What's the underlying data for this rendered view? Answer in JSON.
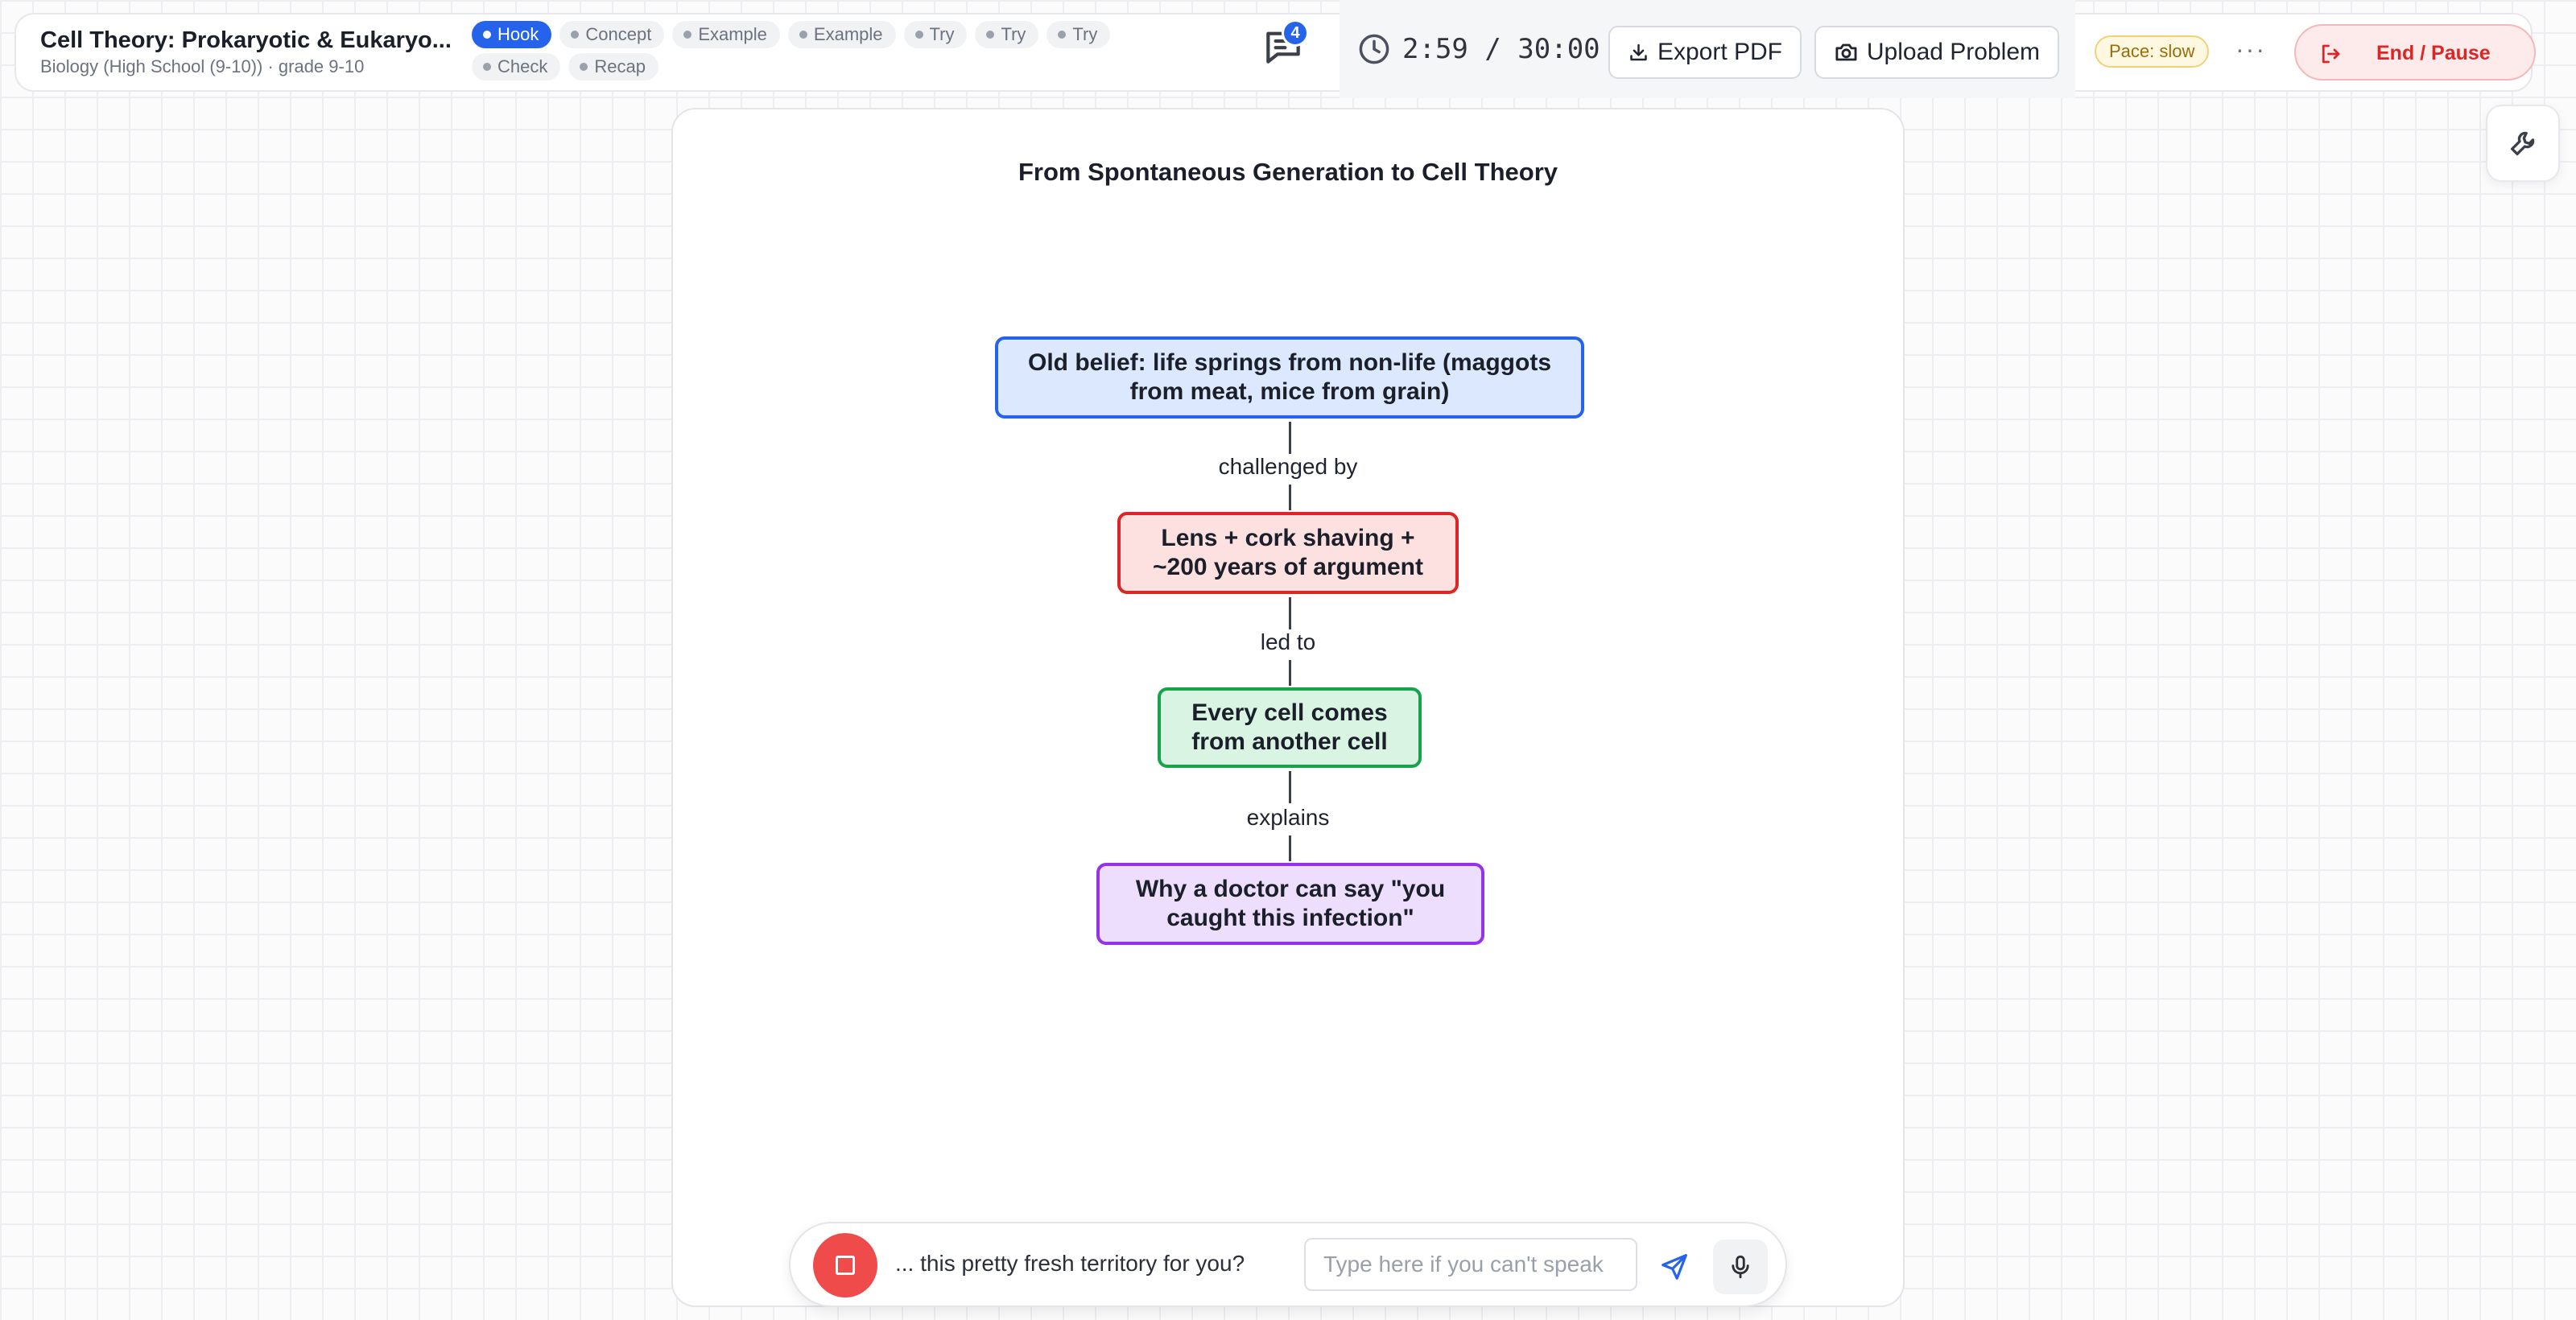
{
  "header": {
    "title": "Cell Theory: Prokaryotic & Eukaryo...",
    "subtitle": "Biology (High School (9-10)) · grade 9-10",
    "chips": [
      {
        "label": "Hook",
        "active": true
      },
      {
        "label": "Concept",
        "active": false
      },
      {
        "label": "Example",
        "active": false
      },
      {
        "label": "Example",
        "active": false
      },
      {
        "label": "Try",
        "active": false
      },
      {
        "label": "Try",
        "active": false
      },
      {
        "label": "Try",
        "active": false
      },
      {
        "label": "Check",
        "active": false
      },
      {
        "label": "Recap",
        "active": false
      }
    ],
    "chat_badge": "4",
    "timer": "2:59 / 30:00",
    "export_label": "Export PDF",
    "upload_label": "Upload Problem",
    "pace": "Pace: slow",
    "more_label": "···",
    "end_label": "End / Pause"
  },
  "diagram": {
    "title": "From Spontaneous Generation to Cell Theory",
    "nodes": [
      {
        "text": "Old belief: life springs from non-life (maggots from meat, mice from grain)",
        "color": "#2563eb"
      },
      {
        "text": "Lens + cork shaving + ~200 years of argument",
        "color": "#dc2626"
      },
      {
        "text": "Every cell comes from another cell",
        "color": "#16a34a"
      },
      {
        "text": "Why a doctor can say \"you caught this infection\"",
        "color": "#9333ea"
      }
    ],
    "edges": [
      "challenged by",
      "led to",
      "explains"
    ]
  },
  "composer": {
    "transcript": "... this pretty fresh territory for you?",
    "placeholder": "Type here if you can't speak"
  },
  "colors": {
    "accent": "#2563eb",
    "danger": "#dc2626",
    "stop": "#ef4b4b",
    "pace_bg": "#fff8e1"
  },
  "icons": {
    "chat": "chat-icon",
    "clock": "clock-icon",
    "download": "download-icon",
    "camera": "camera-icon",
    "logout": "logout-icon",
    "wrench": "wrench-icon",
    "stop": "stop-icon",
    "send": "send-icon",
    "mic": "mic-icon"
  }
}
